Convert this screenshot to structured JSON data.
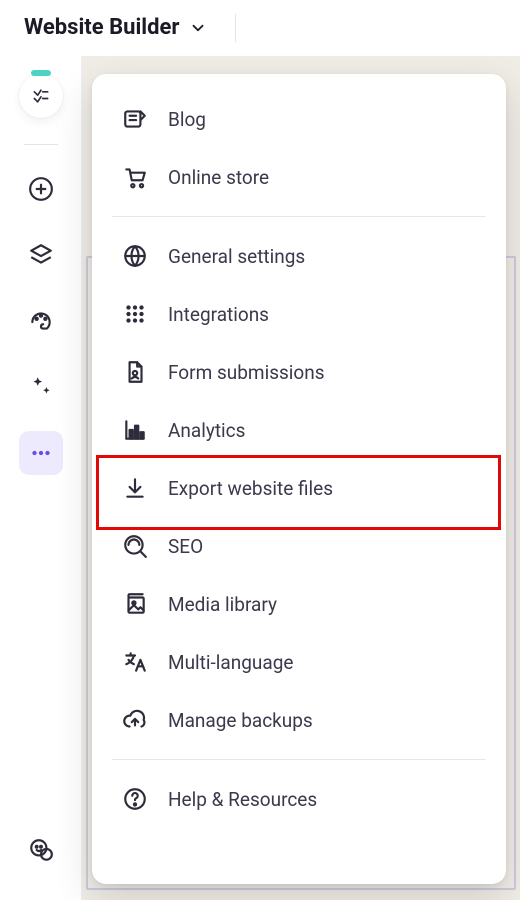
{
  "header": {
    "title": "Website Builder"
  },
  "menu": {
    "blog": "Blog",
    "online_store": "Online store",
    "general_settings": "General settings",
    "integrations": "Integrations",
    "form_submissions": "Form submissions",
    "analytics": "Analytics",
    "export_website_files": "Export website files",
    "seo": "SEO",
    "media_library": "Media library",
    "multi_language": "Multi-language",
    "manage_backups": "Manage backups",
    "help_resources": "Help & Resources"
  }
}
